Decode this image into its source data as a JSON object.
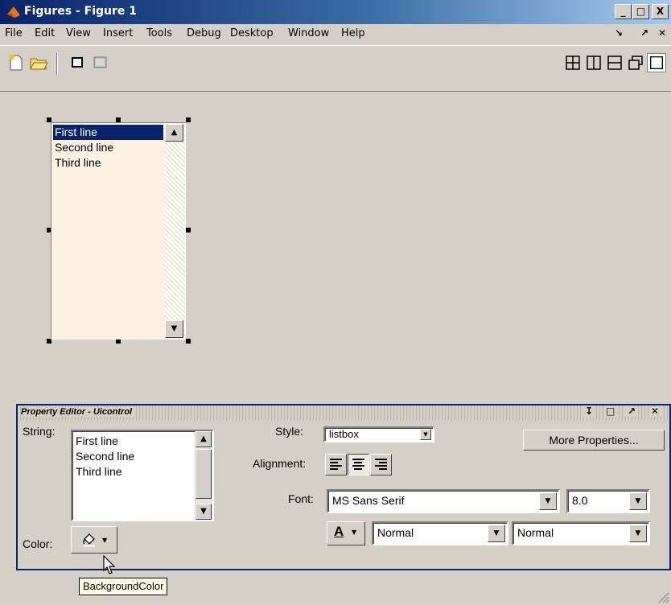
{
  "window": {
    "title": "Figures - Figure 1",
    "minimize": "_",
    "maximize": "□",
    "close": "X"
  },
  "menu": {
    "items": [
      "File",
      "Edit",
      "View",
      "Insert",
      "Tools",
      "Debug",
      "Desktop",
      "Window",
      "Help"
    ],
    "dock_symbol": "↘",
    "undock_symbol": "↗",
    "close_symbol": "✕"
  },
  "toolbar": {
    "icons": [
      "new-figure-icon",
      "open-file-icon",
      "single-window-icon",
      "dock-window-icon"
    ],
    "layout_icons": [
      "grid-2x2-icon",
      "columns-icon",
      "rows-icon",
      "float-icon",
      "maximize-icon"
    ]
  },
  "figure_listbox": {
    "lines": [
      "First line",
      "Second line",
      "Third line"
    ],
    "selected_index": 0
  },
  "property_editor": {
    "title": "Property Editor - Uicontrol",
    "header_controls": [
      "↧",
      "□",
      "↗",
      "✕"
    ],
    "string_label": "String:",
    "string_lines": [
      "First line",
      "Second line",
      "Third line"
    ],
    "style_label": "Style:",
    "style_value": "listbox",
    "alignment_label": "Alignment:",
    "alignment_selected": "center",
    "font_label": "Font:",
    "font_name": "MS Sans Serif",
    "font_size": "8.0",
    "font_weight": "Normal",
    "font_angle": "Normal",
    "color_label": "Color:",
    "more_properties": "More Properties...",
    "font_color_glyph": "A"
  },
  "tooltip": {
    "text": "BackgroundColor"
  },
  "colors": {
    "titlebar_start": "#0a246a",
    "listbox_bg": "#fdf1e1",
    "selection": "#0a246a",
    "panel": "#d4d0c8"
  }
}
